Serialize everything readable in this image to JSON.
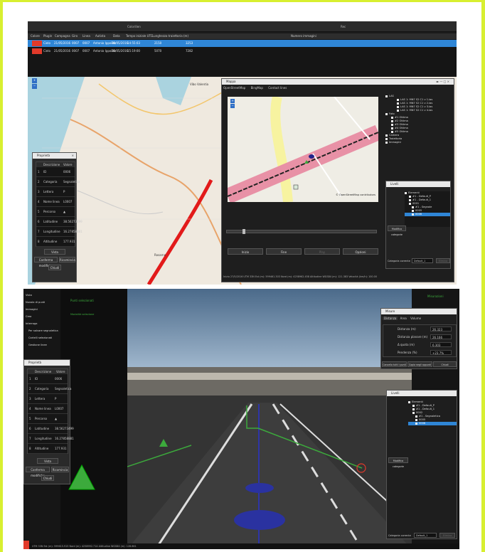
{
  "top": {
    "header_left": "Colorilien",
    "header_right": "Rec",
    "columns": [
      "Colore",
      "Plugin",
      "Campagna",
      "Giro",
      "Linea",
      "Autista",
      "Data",
      "Tempo iniziale UTC",
      "Lunghezza traiettoria (m)",
      "Numero immagini"
    ],
    "rows": [
      {
        "plugin": "Cielo",
        "campagna": "21/05/2016",
        "giro": "0007",
        "linea": "0007",
        "autista": "Antonio Ippolito",
        "data": "20/05/2016",
        "tempo": "14:55:03",
        "lunghezza": "2150",
        "immagini": "3253",
        "color": "#e23a2a",
        "selected": true
      },
      {
        "plugin": "Cielo",
        "campagna": "21/05/2016",
        "giro": "0007",
        "linea": "0007",
        "autista": "Antonio Ippolito",
        "data": "20/05/2016",
        "tempo": "15:19:00",
        "lunghezza": "5070",
        "immagini": "7282",
        "color": "#e23a2a",
        "selected": false
      }
    ],
    "map_places": [
      "Vibo Valentia",
      "Rosarno"
    ]
  },
  "props_top": {
    "title": "Proprietà",
    "col_desc": "Descrizione",
    "col_val": "Valore",
    "rows": [
      [
        "1",
        "ID",
        "0006"
      ],
      [
        "2",
        "Categoria",
        "Segnaletica"
      ],
      [
        "3",
        "Lettera",
        "P"
      ],
      [
        "4",
        "Nome linea",
        "L0007"
      ],
      [
        "5",
        "Percorso",
        "▲"
      ],
      [
        "6",
        "Latitudine",
        "38.56273499"
      ],
      [
        "7",
        "Longitudine",
        "16.27858881"
      ],
      [
        "8",
        "Altitudine",
        "177.931"
      ]
    ],
    "btn_view": "Vista",
    "btn_confirm": "Conferma modifiche",
    "btn_reset": "Ricomincia",
    "btn_close": "Chiudi"
  },
  "mapwin": {
    "title": "Mappa",
    "tabs": [
      "OpenStreetMap",
      "BingMap",
      "Contact lines"
    ],
    "attribution": "© OpenStreetMap contributors",
    "btn_start": "Inizio",
    "btn_end": "Fine",
    "btn_play": "Play",
    "btn_options": "Opzioni",
    "status": "Inizio 27/5/2016   UTM 33N   Est (m): 599461.303  Nord (m): 4258962.458  Altitudine WGS84 (m): 121.383  Velocità (km/h): 100.00"
  },
  "tree_top": {
    "items": [
      "LAS",
      "LAS 1: MN7 S2 C1 v 1.las",
      "LAS 1: MN7 S2 C1 v 2.las",
      "LAS 1: MN7 S2 C1 v 3.las",
      "LAS 1: MN7 S2 C1 v 4.las",
      "Foto",
      "#1 Ottima",
      "#2 Ottima",
      "#3 Ottima",
      "#4 Ottima",
      "#5 Ottima",
      "Camera",
      "Traiettoria",
      "Immagini"
    ],
    "layers_title": "Livelli",
    "layers": [
      "Elementi",
      "#1 - Default_P",
      "#1 - Default_1",
      "0001",
      "#1 - Segnale",
      "0005",
      "0006"
    ],
    "btn_edit": "Modifica categorie",
    "cat_label": "Categoria corrente",
    "cat_value": "Default_1",
    "btn_delete": "Elimina"
  },
  "bottom": {
    "menu": [
      "Vista",
      "Nuvola di punti",
      "Immagini",
      "Crea",
      "Interroga",
      "Per salvare segnaletica verticale",
      "Cartelli selezionati",
      "Gestione linee"
    ],
    "green_tab1": "Punti selezionati",
    "green_tab2": "Modalità selezione",
    "right_tab": "Misurazioni",
    "measure": {
      "title": "Misure",
      "tabs": [
        "Distanza",
        "Area",
        "Volume"
      ],
      "labels": [
        "Distanza (m)",
        "Distanza planare (m)",
        "Δ quota (m)",
        "Pendenza (%)"
      ],
      "values": [
        "26.323",
        "26.166",
        "6.303",
        "+23.7%"
      ],
      "btn_clear": "Cancella tutti i punti",
      "btn_copy": "Copia negli appunti",
      "btn_close": "Chiudi"
    },
    "props": {
      "title": "Proprietà",
      "col_desc": "Descrizione",
      "col_val": "Valore",
      "rows": [
        [
          "1",
          "ID",
          "0006"
        ],
        [
          "2",
          "Categoria",
          "Segnaletica"
        ],
        [
          "3",
          "Lettera",
          "P"
        ],
        [
          "4",
          "Nome linea",
          "L0007"
        ],
        [
          "5",
          "Percorso",
          "▲"
        ],
        [
          "6",
          "Latitudine",
          "38.56273499"
        ],
        [
          "7",
          "Longitudine",
          "16.27858881"
        ],
        [
          "8",
          "Altitudine",
          "177.931"
        ]
      ],
      "btn_view": "Vista",
      "btn_confirm": "Conferma modifiche",
      "btn_reset": "Ricomincia",
      "btn_close": "Chiudi"
    },
    "layers": {
      "title": "Livelli",
      "items": [
        "Elementi",
        "#1 - Default_P",
        "#1 - Default_1",
        "0002",
        "#1 - Segnaletica",
        "0005",
        "0006"
      ],
      "btn_edit": "Modifica categorie",
      "cat_label": "Categoria corrente",
      "cat_value": "Default_1",
      "btn_delete": "Elimina"
    },
    "status": "UTM 33N   Est (m): 599615.915   Nord (m): 4258992.714   Altitudine WGS84 (m): 128.861"
  },
  "colors": {
    "accent": "#2f86d6",
    "border": "#d8ef30",
    "red": "#e23a2a",
    "green": "#3caa3c",
    "dark": "#1b1b1b"
  }
}
